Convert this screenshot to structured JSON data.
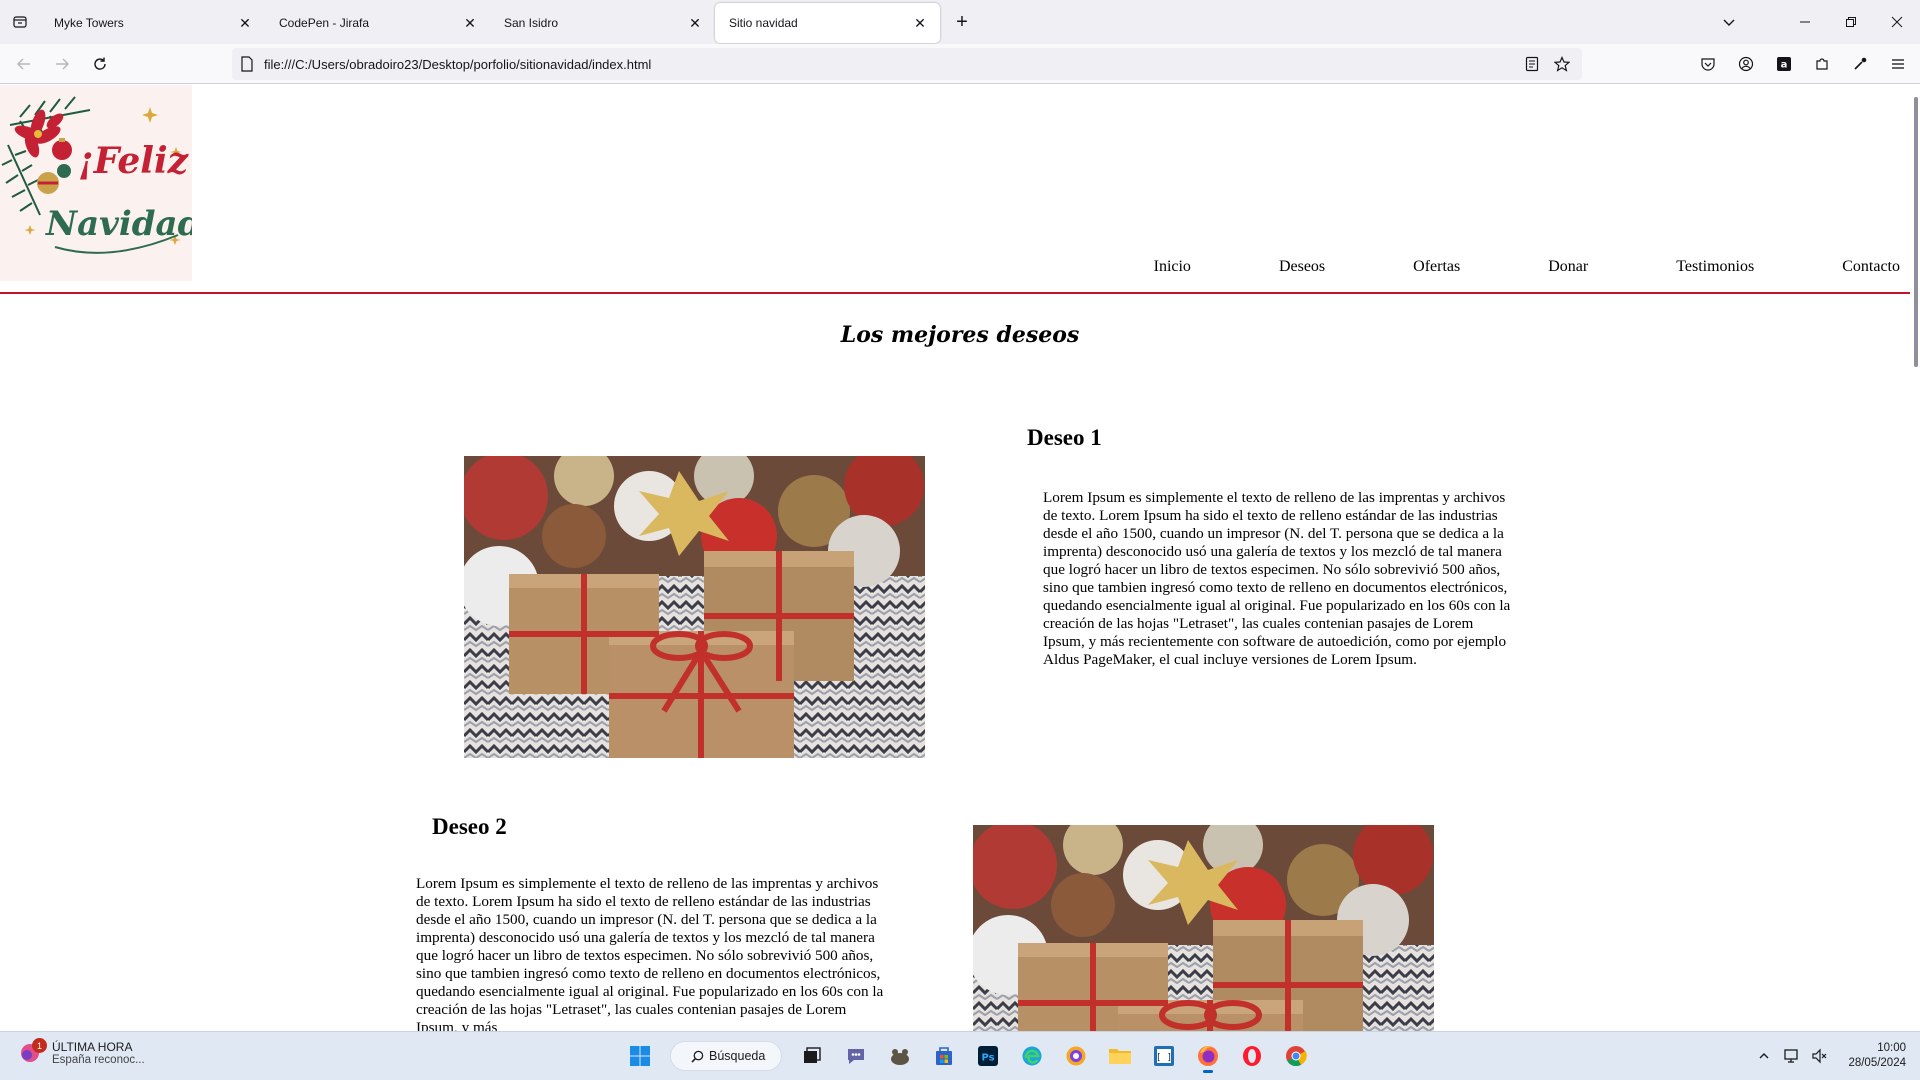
{
  "browser": {
    "tabs": [
      {
        "label": "Myke Towers",
        "selected": false
      },
      {
        "label": "CodePen - Jirafa",
        "selected": false
      },
      {
        "label": "San Isidro",
        "selected": false
      },
      {
        "label": "Sitio navidad",
        "selected": true
      }
    ],
    "url": "file:///C:/Users/obradoiro23/Desktop/porfolio/sitionavidad/index.html"
  },
  "site": {
    "logo": {
      "line1": "¡Feliz",
      "line2": "Navidad"
    },
    "nav": [
      "Inicio",
      "Deseos",
      "Ofertas",
      "Donar",
      "Testimonios",
      "Contacto"
    ],
    "title": "Los mejores deseos",
    "wishes": [
      {
        "title": "Deseo 1",
        "text": "Lorem Ipsum es simplemente el texto de relleno de las imprentas y archivos de texto. Lorem Ipsum ha sido el texto de relleno estándar de las industrias desde el año 1500, cuando un impresor (N. del T. persona que se dedica a la imprenta) desconocido usó una galería de textos y los mezcló de tal manera que logró hacer un libro de textos especimen. No sólo sobrevivió 500 años, sino que tambien ingresó como texto de relleno en documentos electrónicos, quedando esencialmente igual al original. Fue popularizado en los 60s con la creación de las hojas \"Letraset\", las cuales contenian pasajes de Lorem Ipsum, y más recientemente con software de autoedición, como por ejemplo Aldus PageMaker, el cual incluye versiones de Lorem Ipsum."
      },
      {
        "title": "Deseo 2",
        "text": "Lorem Ipsum es simplemente el texto de relleno de las imprentas y archivos de texto. Lorem Ipsum ha sido el texto de relleno estándar de las industrias desde el año 1500, cuando un impresor (N. del T. persona que se dedica a la imprenta) desconocido usó una galería de textos y los mezcló de tal manera que logró hacer un libro de textos especimen. No sólo sobrevivió 500 años, sino que tambien ingresó como texto de relleno en documentos electrónicos, quedando esencialmente igual al original. Fue popularizado en los 60s con la creación de las hojas \"Letraset\", las cuales contenian pasajes de Lorem Ipsum, y más"
      }
    ]
  },
  "taskbar": {
    "news_badge": "1",
    "news_title": "ÚLTIMA HORA",
    "news_sub": "España reconoc...",
    "search": "Búsqueda",
    "time": "10:00",
    "date": "28/05/2024"
  },
  "colors": {
    "accent_red": "#c0152f",
    "logo_green": "#2e6b4f",
    "logo_red": "#c42234"
  }
}
